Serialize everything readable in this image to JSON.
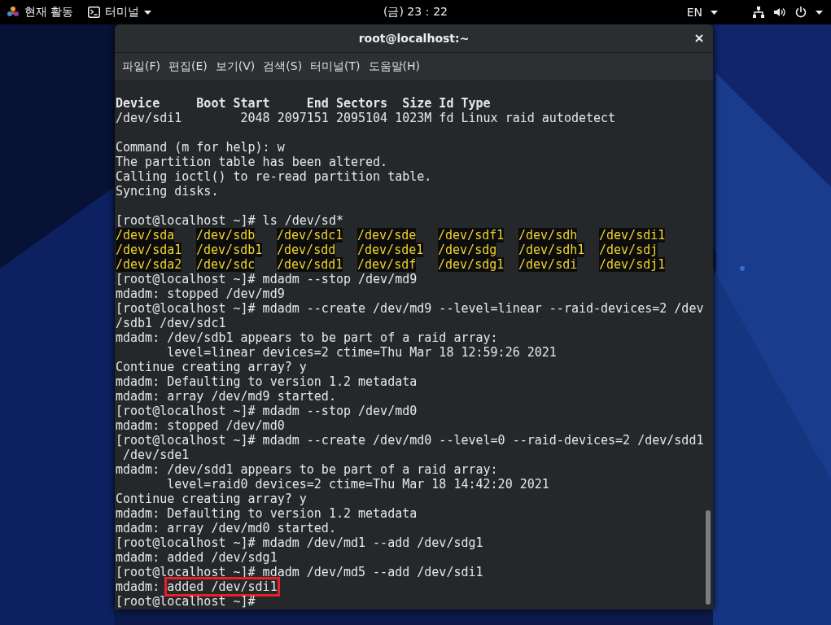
{
  "top_bar": {
    "activities": "현재 활동",
    "app_menu": "터미널",
    "clock": "(금) 23：22",
    "language": "EN"
  },
  "window": {
    "title": "root@localhost:~"
  },
  "menu": [
    "파일(F)",
    "편집(E)",
    "보기(V)",
    "검색(S)",
    "터미널(T)",
    "도움말(H)"
  ],
  "terminal": {
    "lines": [
      {
        "kind": "bold",
        "text": "Device     Boot Start     End Sectors  Size Id Type"
      },
      {
        "kind": "text",
        "text": "/dev/sdi1        2048 2097151 2095104 1023M fd Linux raid autodetect"
      },
      {
        "kind": "blank"
      },
      {
        "kind": "text",
        "text": "Command (m for help): w"
      },
      {
        "kind": "text",
        "text": "The partition table has been altered."
      },
      {
        "kind": "text",
        "text": "Calling ioctl() to re-read partition table."
      },
      {
        "kind": "text",
        "text": "Syncing disks."
      },
      {
        "kind": "blank"
      },
      {
        "kind": "text",
        "text": "[root@localhost ~]# ls /dev/sd*"
      },
      {
        "kind": "ls",
        "items": [
          "/dev/sda",
          "/dev/sdb",
          "/dev/sdc1",
          "/dev/sde",
          "/dev/sdf1",
          "/dev/sdh",
          "/dev/sdi1"
        ]
      },
      {
        "kind": "ls",
        "items": [
          "/dev/sda1",
          "/dev/sdb1",
          "/dev/sdd",
          "/dev/sde1",
          "/dev/sdg",
          "/dev/sdh1",
          "/dev/sdj"
        ]
      },
      {
        "kind": "ls",
        "items": [
          "/dev/sda2",
          "/dev/sdc",
          "/dev/sdd1",
          "/dev/sdf",
          "/dev/sdg1",
          "/dev/sdi",
          "/dev/sdj1"
        ]
      },
      {
        "kind": "text",
        "text": "[root@localhost ~]# mdadm --stop /dev/md9"
      },
      {
        "kind": "text",
        "text": "mdadm: stopped /dev/md9"
      },
      {
        "kind": "text",
        "text": "[root@localhost ~]# mdadm --create /dev/md9 --level=linear --raid-devices=2 /dev"
      },
      {
        "kind": "text",
        "text": "/sdb1 /dev/sdc1"
      },
      {
        "kind": "text",
        "text": "mdadm: /dev/sdb1 appears to be part of a raid array:"
      },
      {
        "kind": "text",
        "text": "       level=linear devices=2 ctime=Thu Mar 18 12:59:26 2021"
      },
      {
        "kind": "text",
        "text": "Continue creating array? y"
      },
      {
        "kind": "text",
        "text": "mdadm: Defaulting to version 1.2 metadata"
      },
      {
        "kind": "text",
        "text": "mdadm: array /dev/md9 started."
      },
      {
        "kind": "text",
        "text": "[root@localhost ~]# mdadm --stop /dev/md0"
      },
      {
        "kind": "text",
        "text": "mdadm: stopped /dev/md0"
      },
      {
        "kind": "text",
        "text": "[root@localhost ~]# mdadm --create /dev/md0 --level=0 --raid-devices=2 /dev/sdd1"
      },
      {
        "kind": "text",
        "text": " /dev/sde1"
      },
      {
        "kind": "text",
        "text": "mdadm: /dev/sdd1 appears to be part of a raid array:"
      },
      {
        "kind": "text",
        "text": "       level=raid0 devices=2 ctime=Thu Mar 18 14:42:20 2021"
      },
      {
        "kind": "text",
        "text": "Continue creating array? y"
      },
      {
        "kind": "text",
        "text": "mdadm: Defaulting to version 1.2 metadata"
      },
      {
        "kind": "text",
        "text": "mdadm: array /dev/md0 started."
      },
      {
        "kind": "text",
        "text": "[root@localhost ~]# mdadm /dev/md1 --add /dev/sdg1"
      },
      {
        "kind": "text",
        "text": "mdadm: added /dev/sdg1"
      },
      {
        "kind": "text",
        "text": "[root@localhost ~]# mdadm /dev/md5 --add /dev/sdi1"
      },
      {
        "kind": "annotated",
        "prefix": "mdadm: ",
        "text": "added /dev/sdi1"
      },
      {
        "kind": "text",
        "text": "[root@localhost ~]#"
      }
    ]
  }
}
